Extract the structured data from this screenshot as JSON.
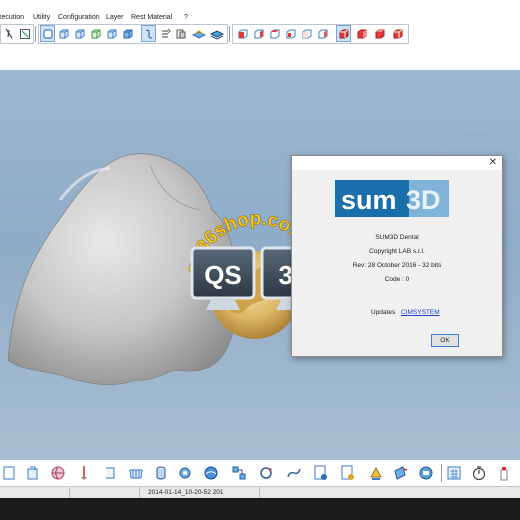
{
  "menu": {
    "items": [
      "xecution",
      "Utility",
      "Configuration",
      "Layer",
      "Rest Material",
      "?"
    ]
  },
  "toolbar": {
    "icons": [
      "cursor-icon",
      "select-icon",
      "view-front-icon",
      "view-back-icon",
      "view-left-icon",
      "view-right-icon",
      "view-top-icon",
      "view-bottom-icon",
      "curve-icon",
      "align-icon",
      "layers-icon",
      "model-icon",
      "red-cube-1-icon",
      "red-cube-2-icon",
      "red-cube-3-icon",
      "red-cube-4-icon",
      "red-cube-5-icon",
      "red-cube-6-icon",
      "red-cube-7-icon",
      "red-cube-8-icon"
    ]
  },
  "watermark": {
    "arc_text": "qs36shop.com",
    "left_box": "QS",
    "right_box": "36"
  },
  "dialog": {
    "logo_text_dark": "sum",
    "logo_text_light": "3D",
    "product": "SUM3D Dental",
    "copyright": "Copyright LAB s.r.l.",
    "revision": "Rev: 28 October 2016  -  32 bits",
    "code": "Code : 0",
    "updates_label": "Updates",
    "updates_link": "CIMSYSTEM",
    "ok_label": "OK",
    "close_glyph": "✕"
  },
  "bottom_toolbar": {
    "icons": [
      "sheet-icon",
      "clamp-icon",
      "globe-tool-icon",
      "drill-tool-icon",
      "bracket-icon",
      "tray-icon",
      "cylinder-icon",
      "gear-tool-icon",
      "sphere-icon",
      "nodes-icon",
      "rotate-icon",
      "spline-tool-icon",
      "doc-info-icon",
      "doc-settings-icon",
      "paint-icon",
      "bucket-icon",
      "camera-icon",
      "calculator-icon",
      "stopwatch-icon",
      "spray-icon"
    ]
  },
  "status": {
    "filename": "2014-01-14_10-20-52 201"
  },
  "colors": {
    "viewport_bg": "#9bb6d0",
    "logo_blue": "#1a6faa",
    "link_blue": "#1a44c8",
    "ok_border": "#3c7fd6"
  }
}
